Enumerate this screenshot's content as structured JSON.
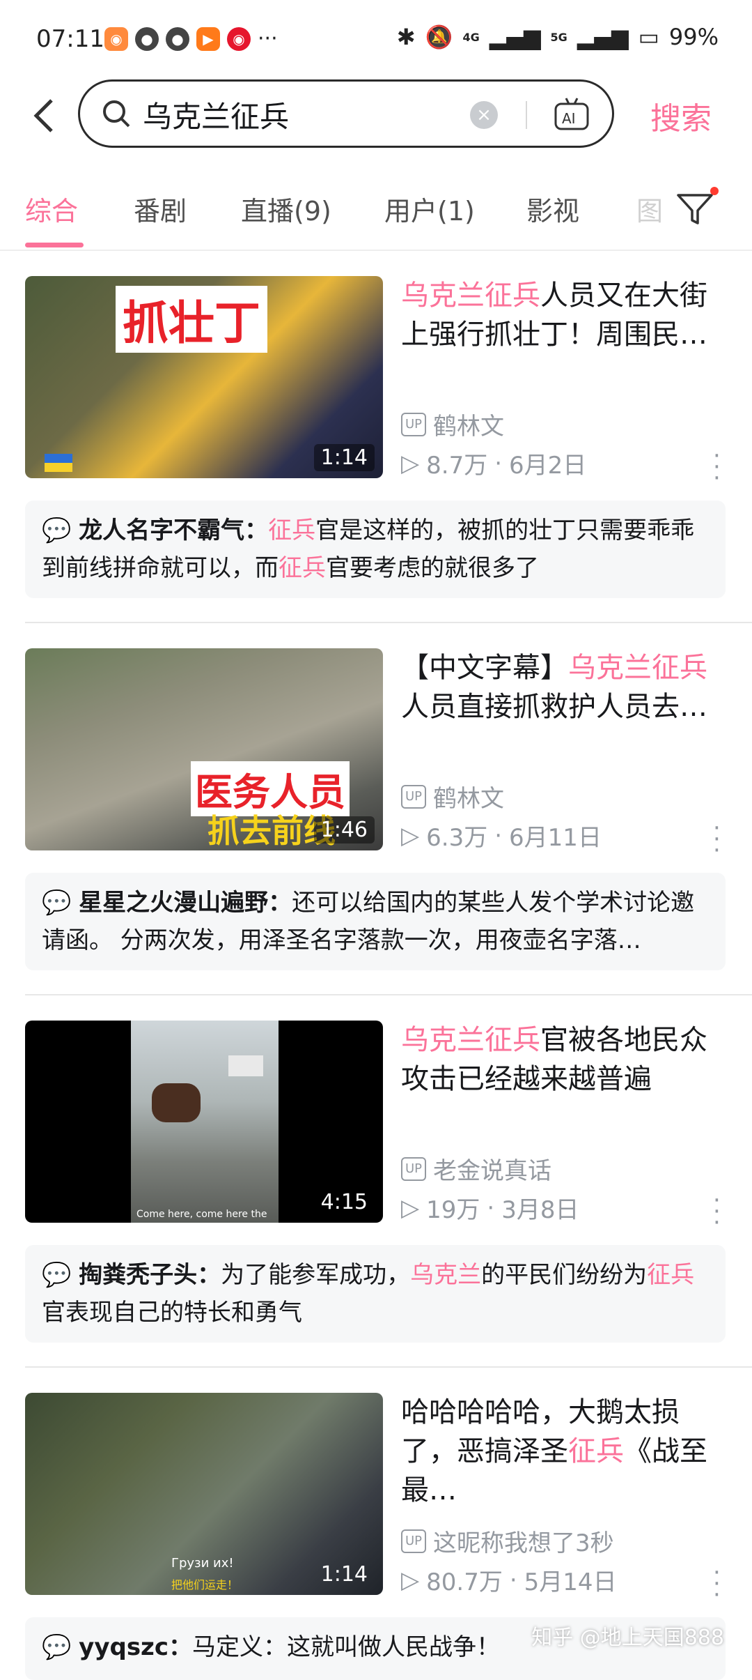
{
  "status_bar": {
    "time": "07:11",
    "battery": "99%",
    "network1": "4G",
    "network2": "5G"
  },
  "search": {
    "query": "乌克兰征兵",
    "button_label": "搜索"
  },
  "tabs": [
    "综合",
    "番剧",
    "直播(9)",
    "用户(1)",
    "影视",
    "图"
  ],
  "results": [
    {
      "title_hl": "乌克兰征兵",
      "title_rest": "人员又在大街上强行抓壮丁！周围民…",
      "uploader": "鹤林文",
      "views": "8.7万",
      "date": "6月2日",
      "duration": "1:14",
      "thumb_text": "抓壮丁",
      "comment_user": "龙人名字不霸气：",
      "comment_p1": "征兵",
      "comment_p2": "官是这样的，被抓的壮丁只需要乖乖到前线拼命就可以，而",
      "comment_p3": "征兵",
      "comment_p4": "官要考虑的就很多了"
    },
    {
      "title_pre": "【中文字幕】",
      "title_hl": "乌克兰征兵",
      "title_rest": "人员直接抓救护人员去…",
      "uploader": "鹤林文",
      "views": "6.3万",
      "date": "6月11日",
      "duration": "1:46",
      "thumb_text1": "医务人员",
      "thumb_text2": "抓去前线",
      "comment_user": "星星之火漫山遍野：",
      "comment_text": "还可以给国内的某些人发个学术讨论邀请函。 分两次发，用泽圣名字落款一次，用夜壶名字落…"
    },
    {
      "title_hl": "乌克兰征兵",
      "title_rest": "官被各地民众攻击已经越来越普遍",
      "uploader": "老金说真话",
      "views": "19万",
      "date": "3月8日",
      "duration": "4:15",
      "thumb_caption": "Come here, come here the",
      "comment_user": "掏粪秃子头：",
      "comment_p1": "为了能参军成功，",
      "comment_p2": "乌克兰",
      "comment_p3": "的平民们纷纷为",
      "comment_p4": "征兵",
      "comment_p5": "官表现自己的特长和勇气"
    },
    {
      "title_pre": "哈哈哈哈哈，大鹅太损了，恶搞泽圣",
      "title_hl": "征兵",
      "title_rest": "《战至最…",
      "uploader": "这昵称我想了3秒",
      "views": "80.7万",
      "date": "5月14日",
      "duration": "1:14",
      "thumb_sub1": "Грузи их!",
      "thumb_sub2": "把他们运走！",
      "comment_user": "yyqszc：",
      "comment_text": "马定义：这就叫做人民战争！"
    }
  ],
  "watermark": "知乎 @地上天国888",
  "colors": {
    "accent": "#fb7299",
    "meta": "#9499a0"
  }
}
